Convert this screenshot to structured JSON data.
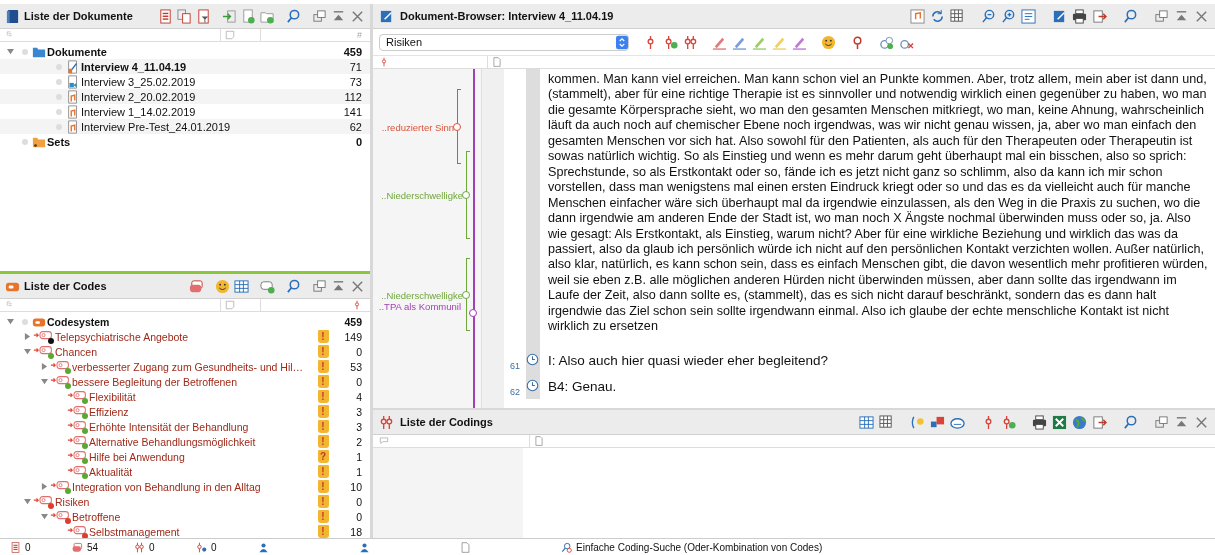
{
  "documents_panel": {
    "title": "Liste der Dokumente",
    "count_header": "#",
    "tree": [
      {
        "label": "Dokumente",
        "count": "459",
        "kind": "folder",
        "expanded": true,
        "children": [
          {
            "label": "Interview 4_11.04.19",
            "count": "71",
            "kind": "text",
            "open": true
          },
          {
            "label": "Interview 3_25.02.2019",
            "count": "73",
            "kind": "video",
            "open": false
          },
          {
            "label": "Interview 2_20.02.2019",
            "count": "112",
            "kind": "audio",
            "open": false
          },
          {
            "label": "Interview 1_14.02.2019",
            "count": "141",
            "kind": "audio",
            "open": false
          },
          {
            "label": "Interview Pre-Test_24.01.2019",
            "count": "62",
            "kind": "audio",
            "open": false
          }
        ]
      },
      {
        "label": "Sets",
        "count": "0",
        "kind": "sets"
      }
    ]
  },
  "codes_panel": {
    "title": "Liste der Codes",
    "tree": [
      {
        "label": "Codesystem",
        "count": "459",
        "kind": "root",
        "expanded": true,
        "children": [
          {
            "label": "Telepsychiatrische Angebote",
            "count": "149",
            "color": "#111111",
            "memo": "!",
            "expanded": false
          },
          {
            "label": "Chancen",
            "count": "0",
            "color": "#5aa832",
            "memo": "!",
            "expanded": true,
            "children": [
              {
                "label": "verbesserter Zugang zum Gesundheits- und Hil…",
                "count": "53",
                "color": "#5aa832",
                "memo": "!",
                "expanded": false
              },
              {
                "label": "bessere Begleitung der Betroffenen",
                "count": "0",
                "color": "#5aa832",
                "memo": "!",
                "expanded": true,
                "children": [
                  {
                    "label": "Flexibilität",
                    "count": "4",
                    "color": "#5aa832",
                    "memo": "!"
                  },
                  {
                    "label": "Effizienz",
                    "count": "3",
                    "color": "#5aa832",
                    "memo": "!"
                  },
                  {
                    "label": "Erhöhte Intensität der Behandlung",
                    "count": "3",
                    "color": "#5aa832",
                    "memo": "!"
                  },
                  {
                    "label": "Alternative Behandlungsmöglichkeit",
                    "count": "2",
                    "color": "#5aa832",
                    "memo": "!"
                  },
                  {
                    "label": "Hilfe bei Anwendung",
                    "count": "1",
                    "color": "#5aa832",
                    "memo": "?"
                  },
                  {
                    "label": "Aktualität",
                    "count": "1",
                    "color": "#5aa832",
                    "memo": "!"
                  }
                ]
              },
              {
                "label": "Integration von Behandlung in den Alltag",
                "count": "10",
                "color": "#5aa832",
                "memo": "!",
                "expanded": false
              }
            ]
          },
          {
            "label": "Risiken",
            "count": "0",
            "color": "#e03c2c",
            "memo": "!",
            "expanded": true,
            "children": [
              {
                "label": "Betroffene",
                "count": "0",
                "color": "#e03c2c",
                "memo": "!",
                "expanded": true,
                "children": [
                  {
                    "label": "Selbstmanagement",
                    "count": "18",
                    "color": "#e03c2c",
                    "memo": "!"
                  }
                ]
              }
            ]
          }
        ]
      }
    ]
  },
  "document_browser": {
    "title": "Dokument-Browser: Interview 4_11.04.19",
    "code_select": "Risiken",
    "codings": [
      {
        "label": "..reduzierter Sinn",
        "color": "#d9543a"
      },
      {
        "label": "..Niederschwelligke",
        "color": "#6fa83a"
      },
      {
        "label": "..Niederschwelligke",
        "color": "#6fa83a"
      },
      {
        "label": "..TPA als Kommunil",
        "color": "#a23fb5"
      }
    ],
    "paragraphs": [
      {
        "text": "kommen. Man kann viel erreichen. Man kann schon viel an Punkte kommen. Aber, trotz allem, mein aber ist dann und, (stammelt), aber für eine richtige Therapie ist es sinnvoller und notwendig wirklich einen gegenüber zu haben, wo man die gesamte Körpersprache sieht, wo man den gesamten Menschen mitkriegt, wo man, keine Ahnung, wahrscheinlich läuft da auch noch auf chemischer Ebene noch irgendwas, was wir nicht genau wissen, ja, aber wo man einfach den gesamten Menschen vor sich hat. Also sowohl für den Patienten, als auch für den Therapeuten oder Therapeutin ist sowas natürlich wichtig. So als Einstieg und wenn es mehr darum geht überhaupt mal ein bisschen, also so sprich: Sprechstunde, so als Erstkontakt oder so, fände ich es jetzt nicht ganz so schlimm, also da kann ich mir schon vorstellen, dass man wenigstens mal einen ersten Eindruck kriegt oder so und das es da vielleicht auch für manche Menschen einfacher wäre sich überhaupt mal da irgendwie einzulassen, als den Weg in die Praxis zu suchen, wo die dann irgendwie am anderen Ende der Stadt ist, wo man noch X Ängste nochmal überwinden muss oder so, ja. Also wie gesagt: Als Erstkontakt, als Einstieg, warum nicht? Aber für eine wirkliche Beziehung und wirklich das was da passiert, also da glaub ich persönlich würde ich nicht auf den persönlichen Kontakt verzichten wollen. Außer natürlich, also klar, natürlich, es kann schon sein, dass es einfach Menschen gibt, die davon wesentlich mehr profitieren würden, weil sie eben z.B. alle möglichen anderen Hürden nicht überwinden müssen, aber dann sollte das irgendwann im Laufe der Zeit, also dann sollte es, (stammelt), das es sich nicht darauf beschränkt, sondern das es dann halt irgendwie das Ziel schon sein sollte irgendwann einmal. Also ich glaube der echte menschliche Kontakt ist nicht wirklich zu ersetzen"
      },
      {
        "number": "61",
        "text": "I: Also auch hier quasi wieder eher begleitend?"
      },
      {
        "number": "62",
        "text": "B4: Genau."
      }
    ]
  },
  "codings_panel": {
    "title": "Liste der Codings"
  },
  "status_bar": {
    "documents": "0",
    "codes": "54",
    "codings": "0",
    "memos": "0",
    "search_mode": "Einfache Coding-Suche (Oder-Kombination von Codes)"
  }
}
